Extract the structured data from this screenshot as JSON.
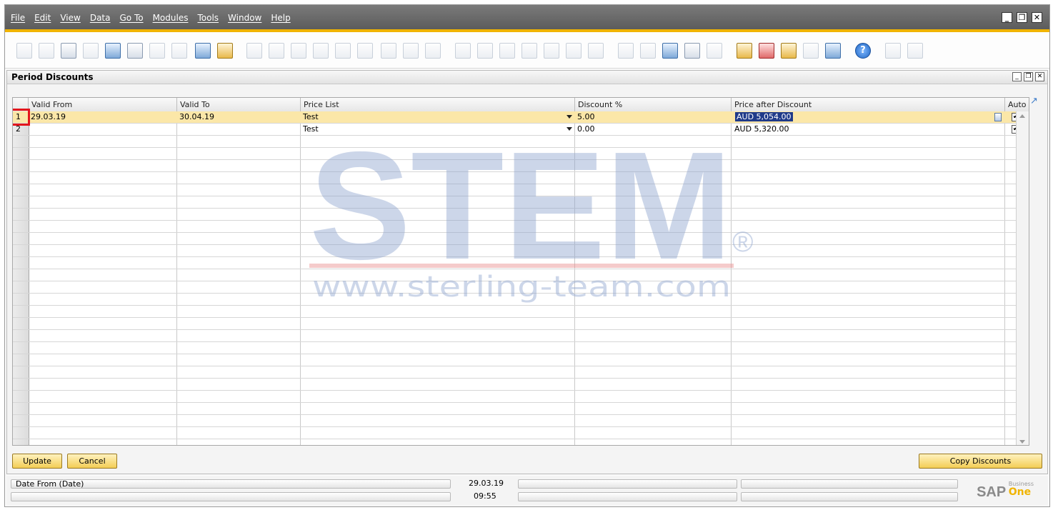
{
  "menu": {
    "items": [
      "File",
      "Edit",
      "View",
      "Data",
      "Go To",
      "Modules",
      "Tools",
      "Window",
      "Help"
    ]
  },
  "window": {
    "title": "Period Discounts"
  },
  "grid": {
    "columns": [
      "",
      "Valid From",
      "Valid To",
      "Price List",
      "Discount %",
      "Price after Discount",
      "Auto"
    ],
    "rows": [
      {
        "num": "1",
        "valid_from": "29.03.19",
        "valid_to": "30.04.19",
        "price_list": "Test",
        "discount": "5.00",
        "price_after": "AUD 5,054.00",
        "auto": "✔"
      },
      {
        "num": "2",
        "valid_from": "",
        "valid_to": "",
        "price_list": "Test",
        "discount": "0.00",
        "price_after": "AUD 5,320.00",
        "auto": "✔"
      }
    ]
  },
  "buttons": {
    "update": "Update",
    "cancel": "Cancel",
    "copy": "Copy Discounts"
  },
  "watermark": {
    "logo": "STEM",
    "reg": "®",
    "url": "www.sterling-team.com"
  },
  "status": {
    "field_label": "Date From (Date)",
    "date": "29.03.19",
    "time": "09:55"
  },
  "brand": {
    "sap": "SAP",
    "business": "Business",
    "one": "One"
  },
  "colors": {
    "accent": "#f0b400",
    "selected_row": "#fbe7a8",
    "highlight": "#1f3a8a",
    "marker": "#e3161c"
  }
}
